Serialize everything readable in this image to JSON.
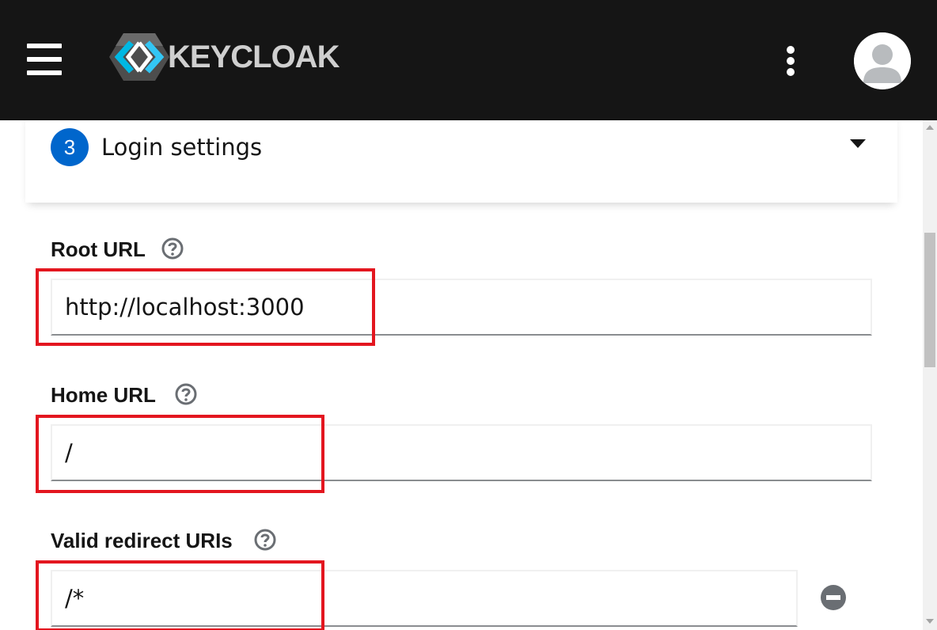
{
  "app": {
    "brand": "KEYCLOAK",
    "icons": {
      "menu": "hamburger-menu-icon",
      "more": "kebab-menu-icon",
      "user": "user-avatar-icon",
      "logo": "keycloak-logo-icon"
    }
  },
  "section": {
    "step_number": "3",
    "title": "Login settings",
    "expanded": true
  },
  "fields": {
    "root_url": {
      "label": "Root URL",
      "value": "http://localhost:3000"
    },
    "home_url": {
      "label": "Home URL",
      "value": "/"
    },
    "redirect_uris": {
      "label": "Valid redirect URIs",
      "values": [
        "/*"
      ]
    }
  },
  "colors": {
    "header_bg": "#151515",
    "accent": "#0066cc",
    "highlight": "#e3161f"
  }
}
